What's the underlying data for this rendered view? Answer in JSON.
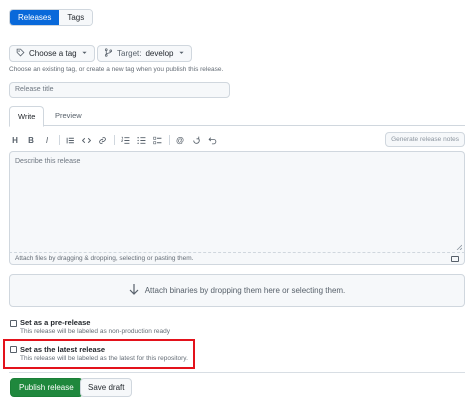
{
  "nav": {
    "releases_label": "Releases",
    "tags_label": "Tags"
  },
  "tag_picker": {
    "choose_label": "Choose a tag",
    "target_prefix": "Target:",
    "target_value": "develop"
  },
  "tag_hint": "Choose an existing tag, or create a new tag when you publish this release.",
  "title_field": {
    "placeholder": "Release title"
  },
  "editor": {
    "tabs": [
      {
        "label": "Write",
        "active": true
      },
      {
        "label": "Preview",
        "active": false
      }
    ],
    "generate_notes_label": "Generate release notes",
    "placeholder": "Describe this release",
    "attach_hint": "Attach files by dragging & dropping, selecting or pasting them."
  },
  "binaries": {
    "label": "Attach binaries by dropping them here or selecting them."
  },
  "options": {
    "prerelease": {
      "title": "Set as a pre-release",
      "desc": "This release will be labeled as non-production ready",
      "checked": false
    },
    "latest": {
      "title": "Set as the latest release",
      "desc": "This release will be labeled as the latest for this repository.",
      "checked": false
    }
  },
  "actions": {
    "publish_label": "Publish release",
    "draft_label": "Save draft"
  },
  "colors": {
    "accent": "#0969da",
    "primary_button": "#1f883d",
    "highlight": "#e3121b"
  }
}
